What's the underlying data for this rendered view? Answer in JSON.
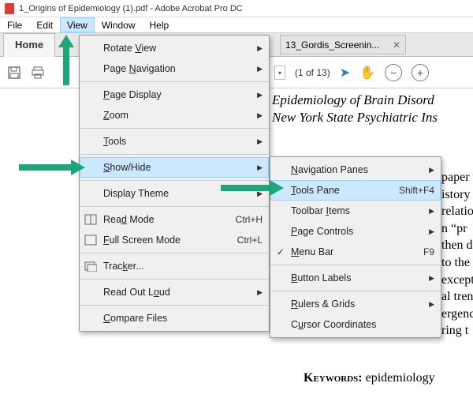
{
  "title": "1_Origins of Epidemiology (1).pdf - Adobe Acrobat Pro DC",
  "menubar": {
    "file": "File",
    "edit": "Edit",
    "view": "View",
    "window": "Window",
    "help": "Help"
  },
  "tabs": {
    "home": "Home",
    "doc_tab": "13_Gordis_Screenin..."
  },
  "view_menu": {
    "rotate": "Rotate View",
    "page_nav": "Page Navigation",
    "page_display": "Page Display",
    "zoom": "Zoom",
    "tools": "Tools",
    "show_hide": "Show/Hide",
    "display_theme": "Display Theme",
    "read_mode": "Read Mode",
    "read_mode_sc": "Ctrl+H",
    "full_screen": "Full Screen Mode",
    "full_screen_sc": "Ctrl+L",
    "tracker": "Tracker...",
    "read_out": "Read Out Loud",
    "compare": "Compare Files"
  },
  "sub_menu": {
    "nav_panes": "Navigation Panes",
    "tools_pane": "Tools Pane",
    "tools_pane_sc": "Shift+F4",
    "toolbar_items": "Toolbar Items",
    "page_controls": "Page Controls",
    "menu_bar": "Menu Bar",
    "menu_bar_sc": "F9",
    "button_labels": "Button Labels",
    "rulers": "Rulers & Grids",
    "cursor": "Cursor Coordinates"
  },
  "page_info": {
    "count": "(1 of 13)"
  },
  "paper": {
    "line1": "Epidemiology of Brain Disord",
    "line2": "New York State Psychiatric Ins",
    "body": "paper v\nistory\nrelatio\nn “pr\nthen d\nto the\nexcept\nal tren\nergenc\nring t",
    "keywords_label": "Keywords:",
    "keywords_text": "epidemiology"
  }
}
